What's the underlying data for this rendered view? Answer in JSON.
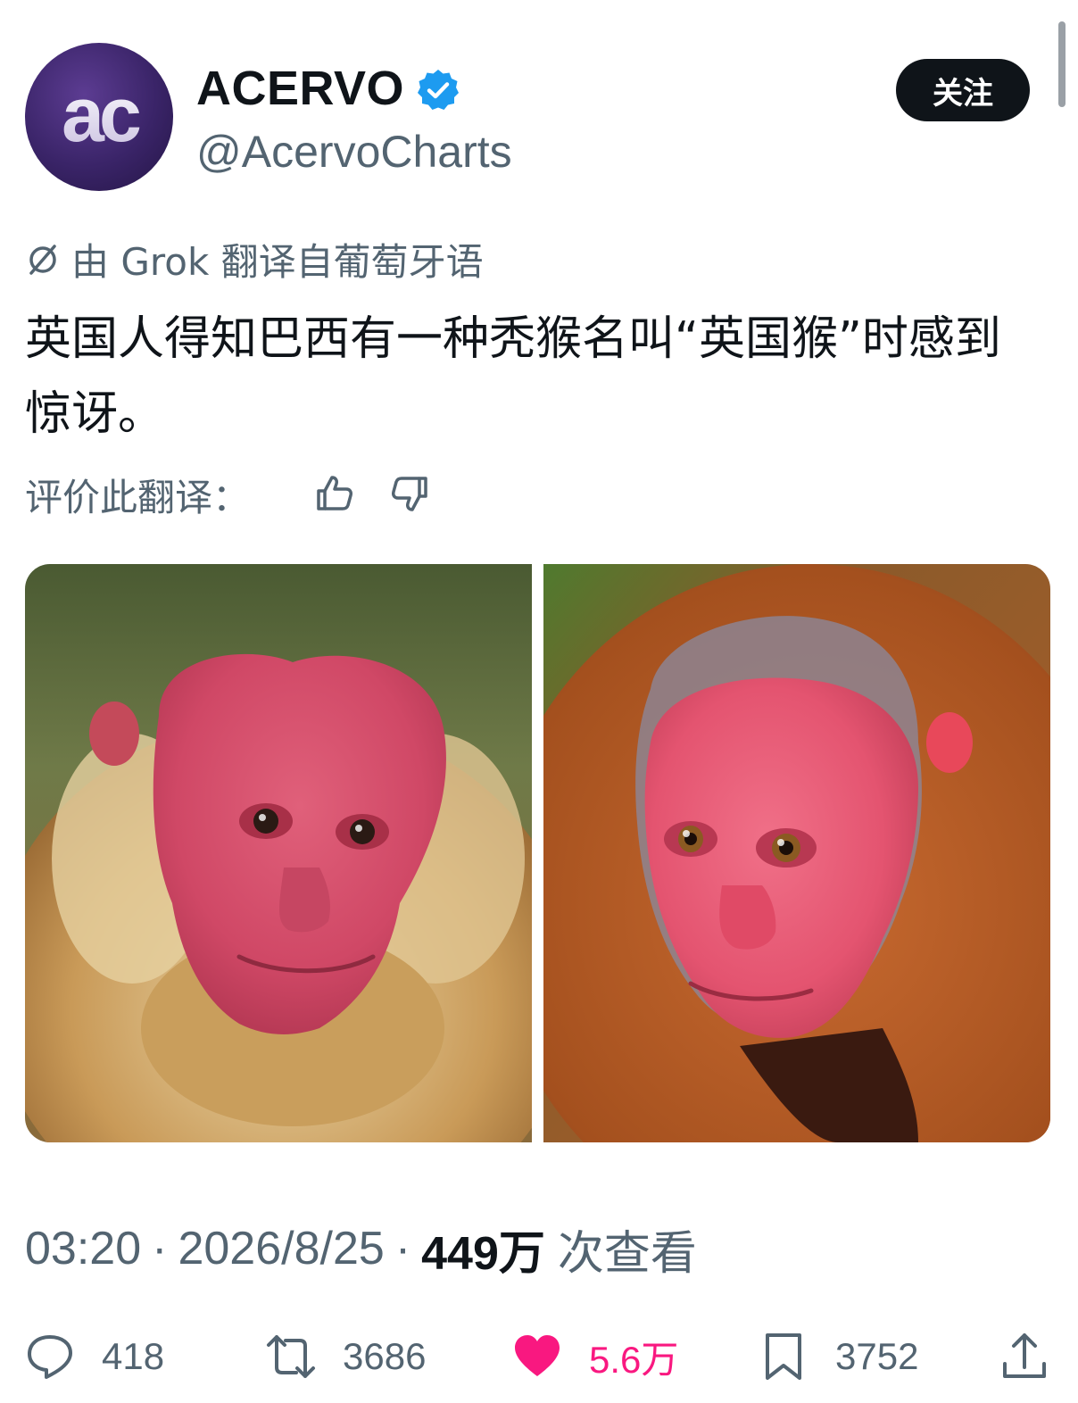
{
  "tweet": {
    "author": {
      "name": "ACERVO",
      "handle": "@AcervoCharts",
      "avatar_text": "ac",
      "verified": true,
      "verified_color": "#1d9bf0"
    },
    "follow_label": "关注",
    "translation_notice": "由 Grok 翻译自葡萄牙语",
    "text": "英国人得知巴西有一种秃猴名叫“英国猴”时感到惊讶。",
    "rate_label": "评价此翻译：",
    "images": [
      {
        "subject": "bald uakari with pale fur and red face"
      },
      {
        "subject": "bald uakari with red-brown fur and red face"
      }
    ],
    "meta": {
      "time": "03:20",
      "separator": "·",
      "date": "2026/8/25",
      "views_count": "449万",
      "views_label": "次查看"
    },
    "actions": {
      "replies": "418",
      "retweets": "3686",
      "likes": "5.6万",
      "bookmarks": "3752"
    },
    "colors": {
      "text_primary": "#0f1419",
      "text_secondary": "#536471",
      "like": "#f91880"
    },
    "icons": [
      "slash-icon",
      "thumbs-up-icon",
      "thumbs-down-icon",
      "reply-icon",
      "retweet-icon",
      "heart-icon",
      "bookmark-icon",
      "share-icon"
    ]
  }
}
